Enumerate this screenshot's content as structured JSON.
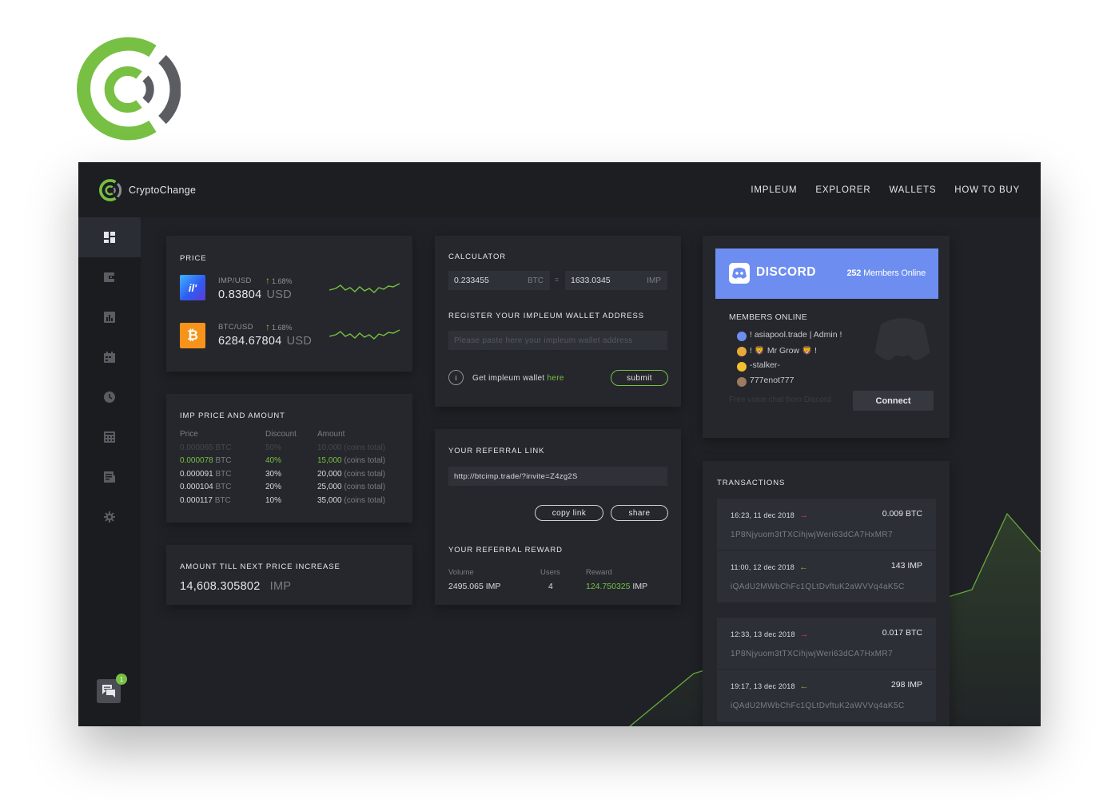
{
  "brand": {
    "name": "CryptoChange",
    "logo_icon": "cryptochange-logo-icon",
    "accent": "#77c043",
    "secondary": "#5b5d63"
  },
  "nav": [
    "IMPLEUM",
    "EXPLORER",
    "WALLETS",
    "HOW TO BUY"
  ],
  "sidebar_icons": [
    "dashboard-icon",
    "wallet-icon",
    "chart-icon",
    "calendar-icon",
    "history-icon",
    "calculator-icon",
    "news-icon",
    "settings-icon"
  ],
  "chat": {
    "badge": "1"
  },
  "price": {
    "title": "PRICE",
    "rows": [
      {
        "pair": "IMP/USD",
        "change": "1.68%",
        "value": "0.83804",
        "unit": "USD",
        "icon": "impleum-icon"
      },
      {
        "pair": "BTC/USD",
        "change": "1.68%",
        "value": "6284.67804",
        "unit": "USD",
        "icon": "bitcoin-icon"
      }
    ]
  },
  "imp_price": {
    "title": "IMP PRICE AND AMOUNT",
    "headers": [
      "Price",
      "Discount",
      "Amount"
    ],
    "rows": [
      {
        "price": "0.000065",
        "cur": "BTC",
        "discount": "50%",
        "amount": "10,000",
        "note": "(coins total)",
        "state": "past"
      },
      {
        "price": "0.000078",
        "cur": "BTC",
        "discount": "40%",
        "amount": "15,000",
        "note": "(coins total)",
        "state": "current"
      },
      {
        "price": "0.000091",
        "cur": "BTC",
        "discount": "30%",
        "amount": "20,000",
        "note": "(coins total)",
        "state": "future"
      },
      {
        "price": "0.000104",
        "cur": "BTC",
        "discount": "20%",
        "amount": "25,000",
        "note": "(coins total)",
        "state": "future"
      },
      {
        "price": "0.000117",
        "cur": "BTC",
        "discount": "10%",
        "amount": "35,000",
        "note": "(coins total)",
        "state": "future"
      }
    ]
  },
  "next_increase": {
    "title": "AMOUNT TILL NEXT PRICE INCREASE",
    "value": "14,608.305802",
    "unit": "IMP"
  },
  "calculator": {
    "title": "CALCULATOR",
    "from_value": "0.233455",
    "from_unit": "BTC",
    "equals": "=",
    "to_value": "1633.0345",
    "to_unit": "IMP",
    "register_title": "REGISTER YOUR IMPLEUM WALLET ADDRESS",
    "wallet_placeholder": "Please paste here your impleum wallet address",
    "info_text": "Get impleum wallet",
    "info_link": "here",
    "submit_label": "submit"
  },
  "referral": {
    "title": "YOUR REFERRAL LINK",
    "link": "http://btcimp.trade/?invite=Z4zg2S",
    "copy_label": "copy link",
    "share_label": "share",
    "reward_title": "YOUR REFERRAL REWARD",
    "headers": [
      "Volume",
      "Users",
      "Reward"
    ],
    "volume": "2495.065 IMP",
    "users": "4",
    "reward": "124.750325",
    "reward_unit": "IMP"
  },
  "discord": {
    "wordmark": "DISCORD",
    "online_count": "252",
    "online_label": "Members Online",
    "members_title": "MEMBERS ONLINE",
    "members": [
      "! asiapool.trade | Admin !",
      "! 🦁 Mr Grow 🦁 !",
      "-stalker-",
      "777enot777"
    ],
    "footer_text": "Free voice chat from Discord",
    "connect_label": "Connect"
  },
  "transactions": {
    "title": "TRANSACTIONS",
    "groups": [
      [
        {
          "time": "16:23, 11 dec 2018",
          "direction": "out",
          "arrow": "→",
          "amount": "0.009 BTC",
          "address": "1P8Njyuom3tTXCihjwjWeri63dCA7HxMR7"
        },
        {
          "time": "11:00, 12 dec 2018",
          "direction": "in",
          "arrow": "←",
          "amount": "143 IMP",
          "address": "iQAdU2MWbChFc1QLtDvftuK2aWVVq4aK5C"
        }
      ],
      [
        {
          "time": "12:33, 13 dec 2018",
          "direction": "out",
          "arrow": "→",
          "amount": "0.017 BTC",
          "address": "1P8Njyuom3tTXCihjwjWeri63dCA7HxMR7"
        },
        {
          "time": "19:17, 13 dec 2018",
          "direction": "in",
          "arrow": "←",
          "amount": "298 IMP",
          "address": "iQAdU2MWbChFc1QLtDvftuK2aWVVq4aK5C"
        }
      ]
    ]
  }
}
